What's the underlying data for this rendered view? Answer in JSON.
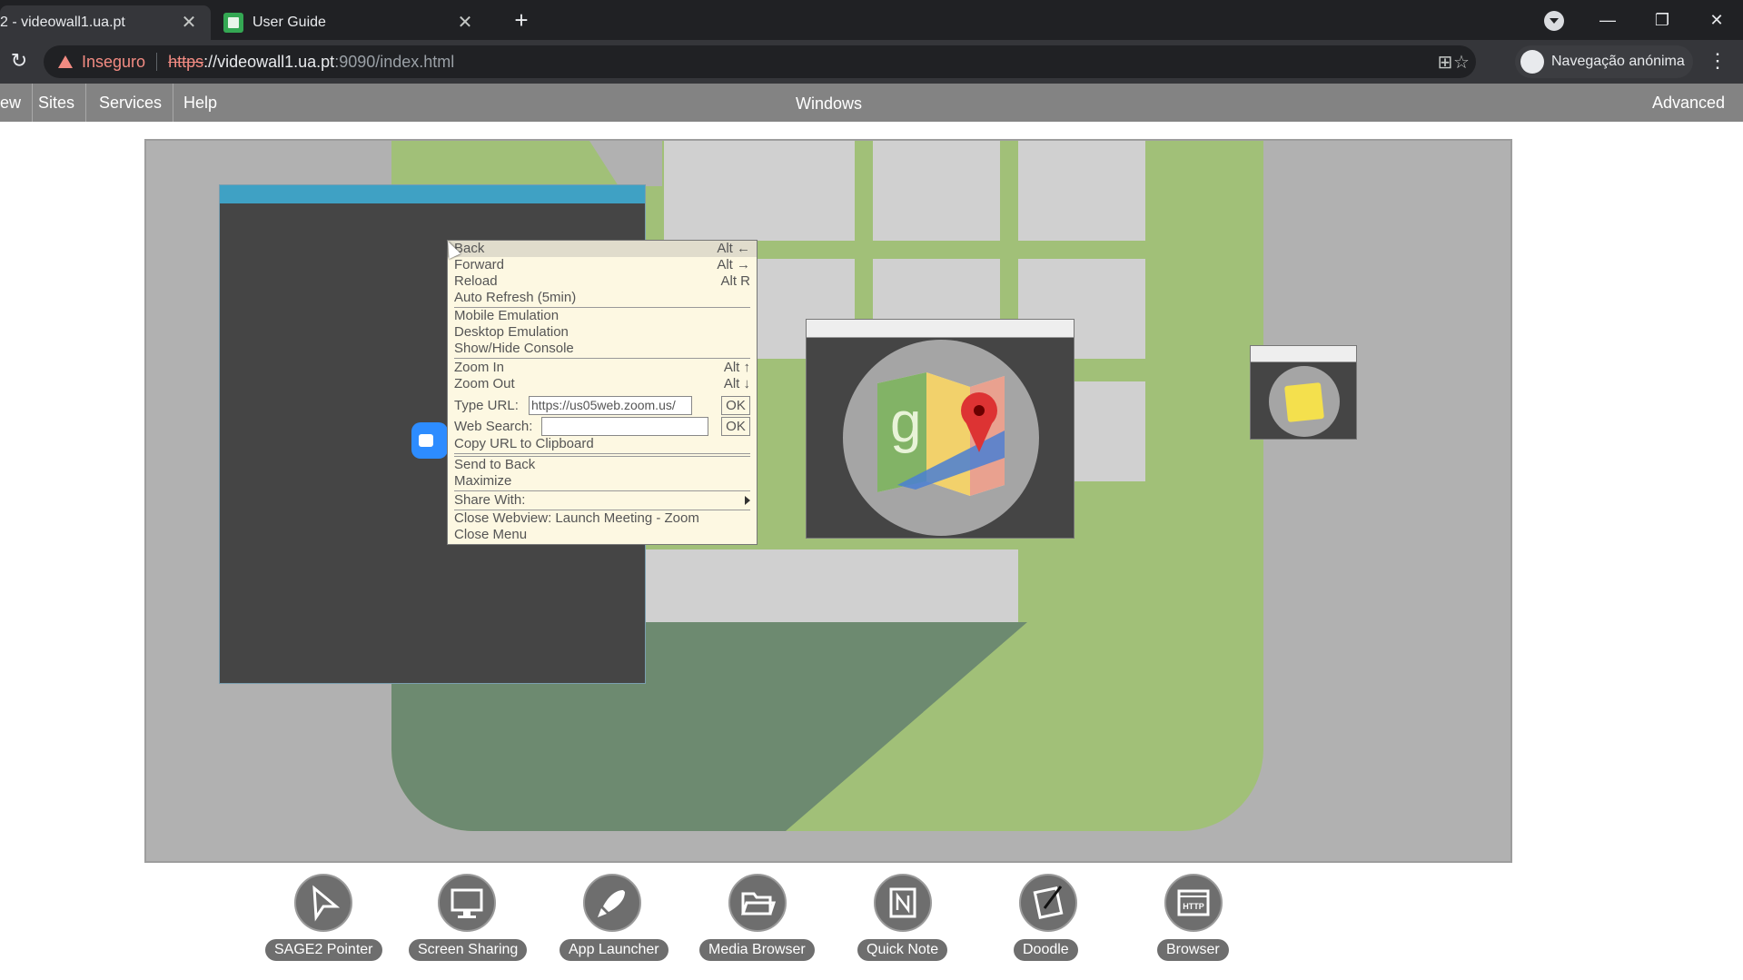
{
  "tabs": [
    {
      "title": "2 - videowall1.ua.pt",
      "active": true
    },
    {
      "title": "User Guide",
      "active": false
    }
  ],
  "address": {
    "security_label": "Inseguro",
    "scheme": "https",
    "host": "://videowall1.ua.pt",
    "path": ":9090/index.html"
  },
  "profile": {
    "label": "Navegação anónima"
  },
  "menubar": {
    "items": [
      "ew",
      "Sites",
      "Services",
      "Help"
    ],
    "center": "Windows",
    "right": "Advanced"
  },
  "context_menu": {
    "back": {
      "label": "Back",
      "shortcut": "Alt ←"
    },
    "forward": {
      "label": "Forward",
      "shortcut": "Alt →"
    },
    "reload": {
      "label": "Reload",
      "shortcut": "Alt R"
    },
    "auto_refresh": "Auto Refresh (5min)",
    "mobile": "Mobile Emulation",
    "desktop": "Desktop Emulation",
    "console": "Show/Hide Console",
    "zoom_in": {
      "label": "Zoom In",
      "shortcut": "Alt ↑"
    },
    "zoom_out": {
      "label": "Zoom Out",
      "shortcut": "Alt ↓"
    },
    "type_url": {
      "label": "Type URL:",
      "value": "https://us05web.zoom.us/",
      "ok": "OK"
    },
    "web_search": {
      "label": "Web Search:",
      "value": "",
      "ok": "OK"
    },
    "copy_url": "Copy URL to Clipboard",
    "send_back": "Send to Back",
    "maximize": "Maximize",
    "share_with": "Share With:",
    "close_webview": "Close Webview: Launch Meeting - Zoom",
    "close_menu": "Close Menu"
  },
  "dock": [
    {
      "label": "SAGE2 Pointer",
      "icon": "pointer-icon"
    },
    {
      "label": "Screen Sharing",
      "icon": "monitor-icon"
    },
    {
      "label": "App Launcher",
      "icon": "rocket-icon"
    },
    {
      "label": "Media Browser",
      "icon": "folder-icon"
    },
    {
      "label": "Quick Note",
      "icon": "note-icon"
    },
    {
      "label": "Doodle",
      "icon": "pen-icon"
    },
    {
      "label": "Browser",
      "icon": "http-icon"
    }
  ],
  "dock_icon_text": {
    "http": "HTTP"
  },
  "colors": {
    "accent_blue": "#3fa1c4",
    "map_green": "#a1c078",
    "menu_bg": "#fdf8e2",
    "insecure_red": "#f28b82"
  }
}
